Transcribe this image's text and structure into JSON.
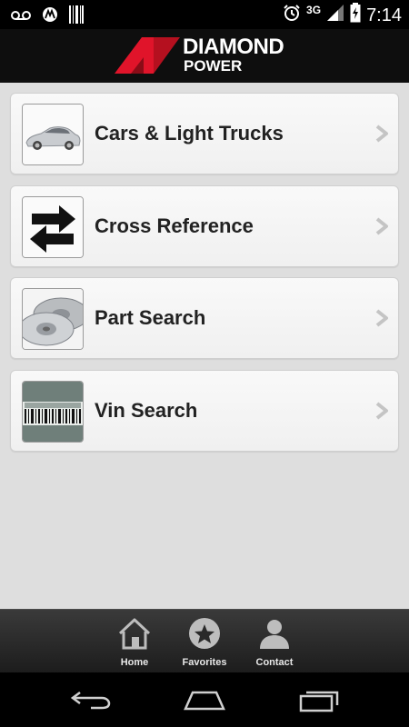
{
  "status_bar": {
    "network": "3G",
    "time": "7:14"
  },
  "header": {
    "brand_line1": "DIAMOND",
    "brand_line2": "POWER"
  },
  "menu": {
    "items": [
      {
        "label": "Cars & Light Trucks",
        "icon": "car-icon"
      },
      {
        "label": "Cross Reference",
        "icon": "swap-arrows-icon"
      },
      {
        "label": "Part Search",
        "icon": "brake-rotor-icon"
      },
      {
        "label": "Vin Search",
        "icon": "barcode-icon"
      }
    ]
  },
  "tabs": [
    {
      "label": "Home",
      "icon": "home-icon"
    },
    {
      "label": "Favorites",
      "icon": "star-icon"
    },
    {
      "label": "Contact",
      "icon": "person-icon"
    }
  ],
  "colors": {
    "brand_red": "#e0142a",
    "header_bg": "#0e0e0e",
    "page_bg": "#dedede"
  }
}
